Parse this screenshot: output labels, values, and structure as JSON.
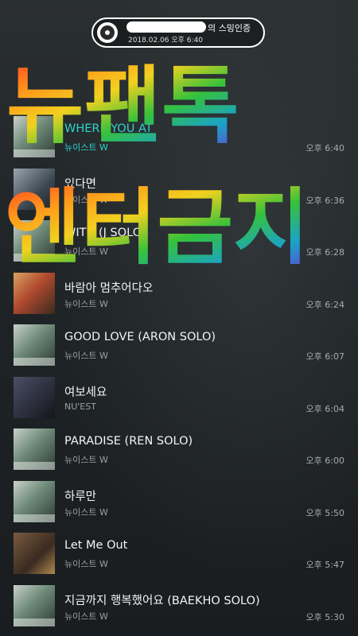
{
  "header": {
    "title_suffix": "의 스밍인증",
    "date": "2018.02.06 오후 6:40"
  },
  "overlay": {
    "line1": "뉴팬톡",
    "line2": "엔터금지"
  },
  "tracks": [
    {
      "title": "WHERE YOU AT",
      "artist": "뉴이스트 W",
      "time": "오후 6:40"
    },
    {
      "title": "있다면",
      "artist": "뉴이스트 W",
      "time": "오후 6:36"
    },
    {
      "title": "WITH (J SOLO)",
      "artist": "뉴이스트 W",
      "time": "오후 6:28"
    },
    {
      "title": "바람아 멈추어다오",
      "artist": "뉴이스트 W",
      "time": "오후 6:24"
    },
    {
      "title": "GOOD LOVE (ARON SOLO)",
      "artist": "뉴이스트 W",
      "time": "오후 6:07"
    },
    {
      "title": "여보세요",
      "artist": "NU'EST",
      "time": "오후 6:04"
    },
    {
      "title": "PARADISE (REN SOLO)",
      "artist": "뉴이스트 W",
      "time": "오후 6:00"
    },
    {
      "title": "하루만",
      "artist": "뉴이스트 W",
      "time": "오후 5:50"
    },
    {
      "title": "Let Me Out",
      "artist": "뉴이스트 W",
      "time": "오후 5:47"
    },
    {
      "title": "지금까지 행복했어요 (BAEKHO SOLO)",
      "artist": "뉴이스트 W",
      "time": "오후 5:30"
    }
  ],
  "colors": {
    "active": "#2ed3cf",
    "overlay_gradient": [
      "#ff3b1f",
      "#ff9b1c",
      "#f1d11e",
      "#35c23a",
      "#1aa3c8",
      "#6a3bd8"
    ]
  }
}
